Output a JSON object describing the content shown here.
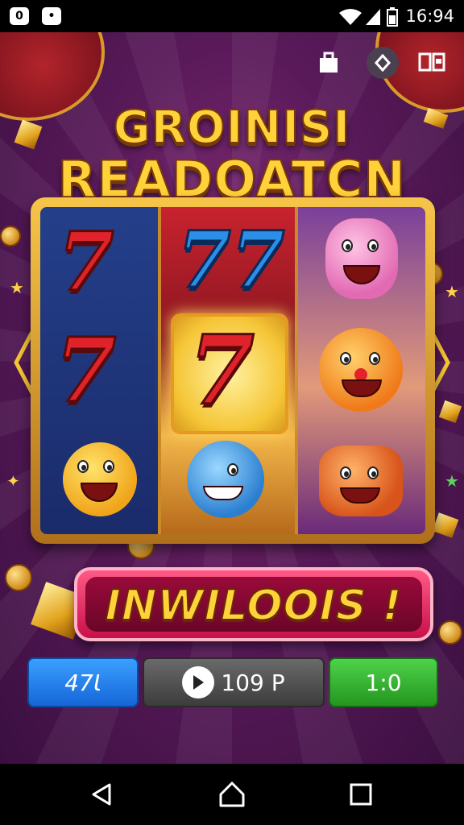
{
  "status_bar": {
    "left_icons": [
      "0",
      "•"
    ],
    "time": "16:94",
    "system_icons": [
      "wifi-icon",
      "signal-icon",
      "battery-icon"
    ]
  },
  "top_icons": [
    "bag-icon",
    "gift-diamond-icon",
    "book-icon"
  ],
  "title": {
    "line1": "GROINISI",
    "line2": "READOATCN"
  },
  "reels": [
    [
      "7",
      "7",
      "duck-symbol"
    ],
    [
      "77",
      "7",
      "dolphin-symbol"
    ],
    [
      "pink-face-symbol",
      "sun-clown-symbol",
      "pot-face-symbol"
    ]
  ],
  "banner": {
    "text": "INWILOOIS !"
  },
  "buttons": {
    "bet": "47Ɩ",
    "spin": "109 P",
    "win": "1:0"
  },
  "colors": {
    "title": "#ffd23a",
    "banner": "#ff5a86",
    "bet_button": "#1566d8",
    "win_button": "#24961f"
  },
  "nav": [
    "back-icon",
    "home-icon",
    "recents-icon"
  ]
}
